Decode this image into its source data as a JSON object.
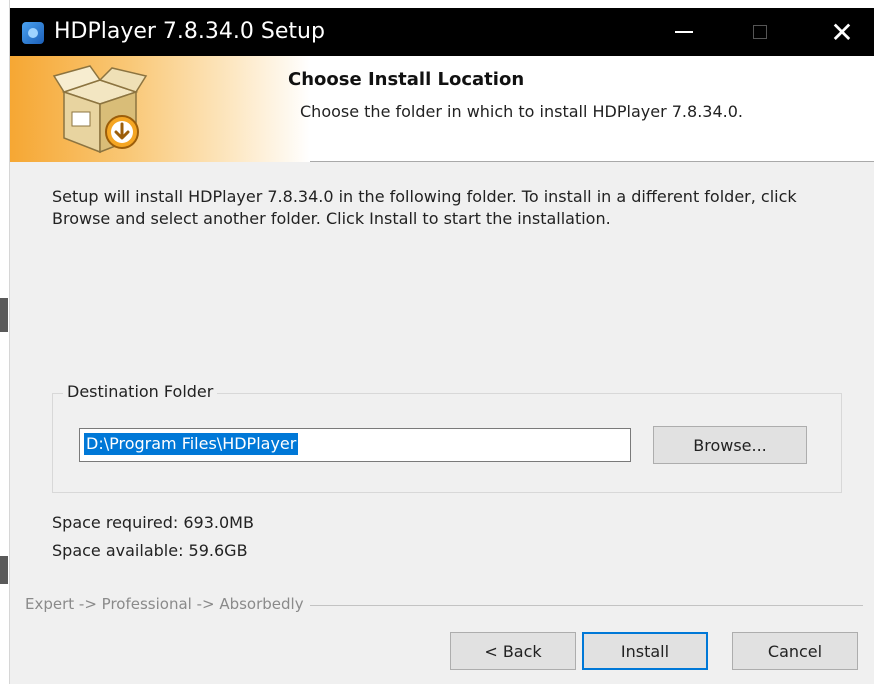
{
  "window": {
    "title": "HDPlayer 7.8.34.0 Setup",
    "controls": {
      "minimize": "—",
      "maximize": "☐",
      "close": "✕"
    }
  },
  "header": {
    "title": "Choose Install Location",
    "subtitle": "Choose the folder in which to install HDPlayer 7.8.34.0.",
    "icon": "installer-box-icon"
  },
  "body": {
    "description": "Setup will install HDPlayer 7.8.34.0 in the following folder. To install in a different folder, click Browse and select another folder. Click Install to start the installation."
  },
  "destination": {
    "group_label": "Destination Folder",
    "path_value": "D:\\Program Files\\HDPlayer",
    "browse_label": "Browse..."
  },
  "space": {
    "required": "Space required: 693.0MB",
    "available": "Space available: 59.6GB"
  },
  "branding": "Expert -> Professional -> Absorbedly",
  "buttons": {
    "back": "< Back",
    "install": "Install",
    "cancel": "Cancel"
  },
  "colors": {
    "titlebar": "#000000",
    "accent": "#0078d7",
    "header_gradient": "#f6a733",
    "dialog_bg": "#f0f0f0"
  }
}
